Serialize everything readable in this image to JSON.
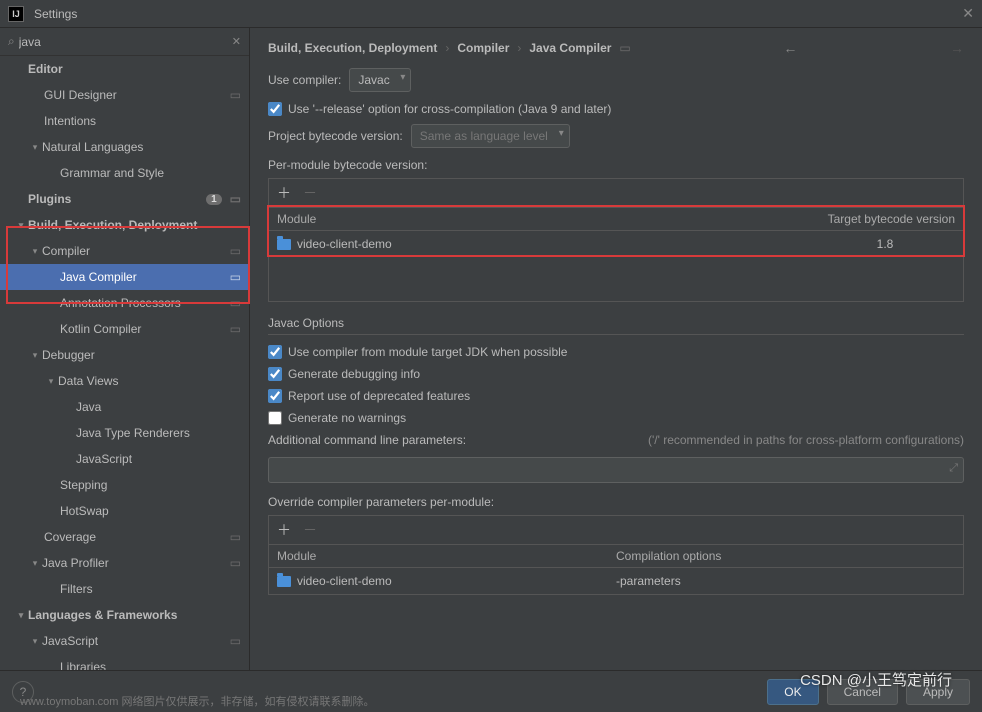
{
  "window": {
    "title": "Settings"
  },
  "search": {
    "value": "java"
  },
  "tree": {
    "editor": "Editor",
    "gui_designer": "GUI Designer",
    "intentions": "Intentions",
    "natural_languages": "Natural Languages",
    "grammar_style": "Grammar and Style",
    "plugins": "Plugins",
    "plugins_badge": "1",
    "bed": "Build, Execution, Deployment",
    "compiler": "Compiler",
    "java_compiler": "Java Compiler",
    "annotation_processors": "Annotation Processors",
    "kotlin_compiler": "Kotlin Compiler",
    "debugger": "Debugger",
    "data_views": "Data Views",
    "java": "Java",
    "java_type_renderers": "Java Type Renderers",
    "javascript": "JavaScript",
    "stepping": "Stepping",
    "hotswap": "HotSwap",
    "coverage": "Coverage",
    "java_profiler": "Java Profiler",
    "filters": "Filters",
    "lang_frameworks": "Languages & Frameworks",
    "js": "JavaScript",
    "libraries": "Libraries"
  },
  "breadcrumb": {
    "a": "Build, Execution, Deployment",
    "b": "Compiler",
    "c": "Java Compiler"
  },
  "compiler_panel": {
    "use_compiler_label": "Use compiler:",
    "use_compiler_value": "Javac",
    "release_option": "Use '--release' option for cross-compilation (Java 9 and later)",
    "project_bytecode_label": "Project bytecode version:",
    "project_bytecode_value": "Same as language level",
    "per_module_label": "Per-module bytecode version:",
    "module_col": "Module",
    "target_col": "Target bytecode version",
    "module_row": {
      "name": "video-client-demo",
      "target": "1.8"
    }
  },
  "javac": {
    "title": "Javac Options",
    "c1": "Use compiler from module target JDK when possible",
    "c2": "Generate debugging info",
    "c3": "Report use of deprecated features",
    "c4": "Generate no warnings",
    "params_label": "Additional command line parameters:",
    "params_hint": "('/' recommended in paths for cross-platform configurations)",
    "override_label": "Override compiler parameters per-module:",
    "override_col1": "Module",
    "override_col2": "Compilation options",
    "override_row": {
      "name": "video-client-demo",
      "opts": "-parameters"
    }
  },
  "footer": {
    "ok": "OK",
    "cancel": "Cancel",
    "apply": "Apply"
  },
  "watermark": "CSDN @小王笃定前行",
  "caption": "www.toymoban.com 网络图片仅供展示，非存储，如有侵权请联系删除。"
}
